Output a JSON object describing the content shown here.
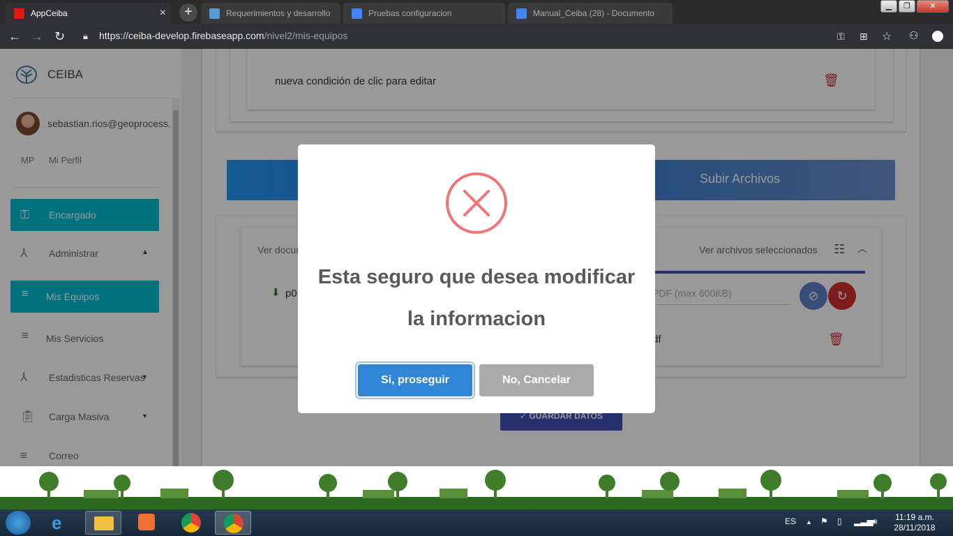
{
  "browser": {
    "active_tab_title": "AppCeiba",
    "other_tabs": [
      "Requerimientos y desarrollo",
      "Pruebas configuracion",
      "Manual_Ceiba (28) - Documento"
    ],
    "url_host": "https://ceiba-develop.firebaseapp.com",
    "url_path": "/nivel2/mis-equipos",
    "new_tab_symbol": "+",
    "close_symbol": "×"
  },
  "sidebar": {
    "brand": "CEIBA",
    "user_email": "sebastian.rios@geoprocess.com",
    "profile_initials": "MP",
    "profile_label": "Mi Perfil",
    "items": [
      {
        "label": "Encargado",
        "icon": "key-icon"
      },
      {
        "label": "Administrar",
        "icon": "network-icon"
      },
      {
        "label": "Mis Equipos",
        "icon": "list-icon"
      },
      {
        "label": "Mis Servicios",
        "icon": "list-icon"
      },
      {
        "label": "Estadisticas Reservas",
        "icon": "network-icon"
      },
      {
        "label": "Carga Masiva",
        "icon": "clipboard-icon"
      },
      {
        "label": "Correo",
        "icon": "list-icon"
      }
    ]
  },
  "main": {
    "condition_text": "nueva condición de clic para editar",
    "upload_header": "Subir Archivos",
    "ver_documentos": "Ver documentos",
    "ver_archivos": "Ver archivos seleccionados",
    "file_name": "p0",
    "file_hint": "PDF (max 600KB)",
    "file_ext": "df",
    "save_button": "GUARDAR DATOS"
  },
  "modal": {
    "title_line1": "Esta seguro que desea modificar",
    "title_line2": "la informacion",
    "confirm_label": "Si, proseguir",
    "cancel_label": "No, Cancelar",
    "error_color": "#f27474",
    "confirm_color": "#3085d6",
    "cancel_color": "#aaaaaa"
  },
  "taskbar": {
    "language": "ES",
    "time": "11:19 a.m.",
    "date": "28/11/2018"
  }
}
